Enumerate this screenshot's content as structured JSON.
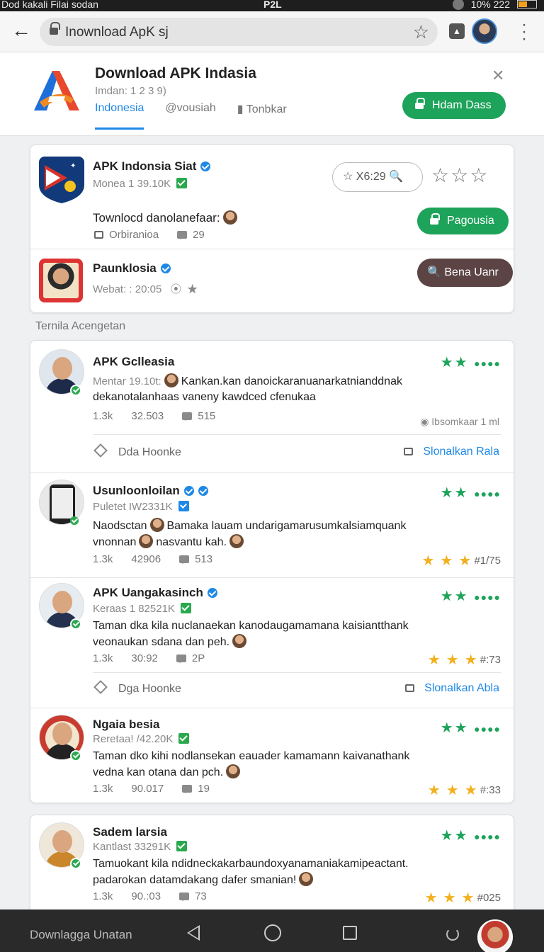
{
  "status_bar": {
    "left": "Dod kakali Filai sodan",
    "center": "P2L",
    "right": "10% 222"
  },
  "browser": {
    "url": "Inownload ApK sj"
  },
  "header": {
    "title": "Download APK Indasia",
    "subtitle": "Imdan: 1 2 3 9)",
    "tabs": [
      "Indonesia",
      "@vousiah",
      "Tonbkar"
    ],
    "action_label": "Hdam Dass",
    "colors": {
      "accent": "#1e88e5",
      "green": "#1ea35a"
    }
  },
  "featured": {
    "title": "APK Indonsia Siat",
    "meta": "Monea 1 39.10K",
    "search_chip": "X6:29",
    "tagline": "Townlocd danolanefaar:",
    "sub_left": "Orbiranioa",
    "sub_count": "29",
    "button": "Pagousia",
    "second_title": "Paunklosia",
    "second_meta": "Webat: : 20:05",
    "second_button": "Bena Uanr"
  },
  "section_title": "Ternila Acengetan",
  "posts": [
    {
      "name": "APK Gclleasia",
      "meta": "Mentar 19.10t:",
      "text1": "Kankan.kan danoickaranuanarkatnianddnak",
      "text2": "dekanotalanhaas vaneny kawdced cfenukaa",
      "stat1": "1.3k",
      "stat2": "32.503",
      "comments": "515",
      "right_info": "Ibsomkaar 1 ml",
      "action_left": "Dda Hoonke",
      "action_right": "Slonalkan Rala"
    },
    {
      "name": "Usunloonloilan",
      "meta": "Puletet IW2331K",
      "text1a": "Naodsctan",
      "text1b": "Bamaka lauam undarigamarusumkalsiamquank",
      "text2a": "vnonnan",
      "text2b": "nasvantu kah.",
      "stat1": "1.3k",
      "stat2": "42906",
      "comments": "513",
      "rating": "#1/75"
    },
    {
      "name": "APK Uangakasinch",
      "meta": "Keraas 1 82521K",
      "text1": "Taman dka kila nuclanaekan kanodaugamamana kaisiantthank",
      "text2": "veonaukan sdana dan peh.",
      "stat1": "1.3k",
      "stat2": "30:92",
      "comments": "2P",
      "rating": "#:73",
      "action_left": "Dga Hoonke",
      "action_right": "Slonalkan Abla"
    },
    {
      "name": "Ngaia besia",
      "meta": "Reretaa! /42.20K",
      "text1": "Taman dko kihi nodlansekan eauader kamamann kaivanathank",
      "text2": "vedna kan otana dan pch.",
      "stat1": "1.3k",
      "stat2": "90.017",
      "comments": "19",
      "rating": "#:33"
    },
    {
      "name": "Sadem larsia",
      "meta": "Kantlast 33291K",
      "text1": "Tamuokant kila ndidneckakarbaundoxyanamaniakamipeactant.",
      "text2": "padarokan datamdakang dafer smanian!",
      "stat1": "1.3k",
      "stat2": "90.:03",
      "comments": "73",
      "rating": "#025"
    }
  ],
  "navbar": {
    "label": "Downlagga Unatan"
  }
}
